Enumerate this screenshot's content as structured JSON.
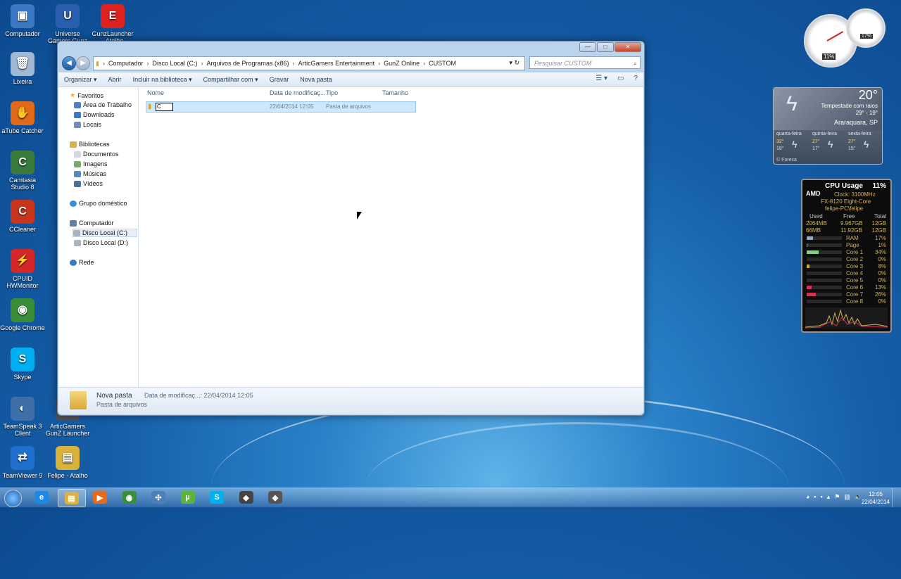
{
  "desktop": {
    "icons": [
      {
        "label": "Computador",
        "color": "#3b78c4",
        "glyph": "▣"
      },
      {
        "label": "Universe Gamers Gunz",
        "color": "#2a5fb0",
        "glyph": "U"
      },
      {
        "label": "GunzLauncher - Atelho",
        "color": "#d22",
        "glyph": "E"
      },
      {
        "label": "Lixeira",
        "color": "#9fb8d4",
        "glyph": "🗑"
      },
      {
        "label": "aTube Catcher",
        "color": "#e06a1a",
        "glyph": "✋"
      },
      {
        "label": "Camtasia Studio 8",
        "color": "#3a7a3a",
        "glyph": "C"
      },
      {
        "label": "CCleaner",
        "color": "#c8351d",
        "glyph": "C"
      },
      {
        "label": "CPUID HWMonitor",
        "color": "#d42828",
        "glyph": "⚡"
      },
      {
        "label": "Google Chrome",
        "color": "#3a8e3a",
        "glyph": "◉"
      },
      {
        "label": "Skype",
        "color": "#00aff0",
        "glyph": "S"
      },
      {
        "label": "TeamSpeak 3 Client",
        "color": "#3f6fa8",
        "glyph": "◐"
      },
      {
        "label": "ArticGamers GunZ Launcher",
        "color": "#555",
        "glyph": "A"
      },
      {
        "label": "TeamViewer 9",
        "color": "#1f6fcc",
        "glyph": "⇄"
      },
      {
        "label": "Felipe - Atalho",
        "color": "#d8b23a",
        "glyph": "▤"
      }
    ]
  },
  "explorer": {
    "window_buttons": {
      "minimize": "—",
      "maximize": "□",
      "close": "✕"
    },
    "address_segments": [
      "Computador",
      "Disco Local (C:)",
      "Arquivos de Programas (x86)",
      "ArticGamers Entertainment",
      "GunZ Online",
      "CUSTOM"
    ],
    "search_placeholder": "Pesquisar CUSTOM",
    "toolbar": [
      "Organizar ▾",
      "Abrir",
      "Incluir na biblioteca ▾",
      "Compartilhar com ▾",
      "Gravar",
      "Nova pasta"
    ],
    "nav": {
      "favorites": "Favoritos",
      "fav_items": [
        "Área de Trabalho",
        "Downloads",
        "Locais"
      ],
      "libraries": "Bibliotecas",
      "lib_items": [
        "Documentos",
        "Imagens",
        "Músicas",
        "Vídeos"
      ],
      "homegroup": "Grupo doméstico",
      "computer": "Computador",
      "drives": [
        "Disco Local (C:)",
        "Disco Local (D:)"
      ],
      "network": "Rede"
    },
    "columns": {
      "name": "Nome",
      "date": "Data de modificaç...",
      "type": "Tipo",
      "size": "Tamanho"
    },
    "file": {
      "rename_text": "C",
      "date": "22/04/2014 12:05",
      "type": "Pasta de arquivos"
    },
    "details": {
      "name": "Nova pasta",
      "type": "Pasta de arquivos",
      "date_label": "Data de modificaç...: 22/04/2014 12:05"
    }
  },
  "gadgets": {
    "clock": {
      "cpu_pct": "11%",
      "mem_pct": "17%"
    },
    "weather": {
      "temp": "20°",
      "condition": "Tempestade com raios",
      "range": "29° - 19°",
      "city": "Araraquara, SP",
      "days": [
        {
          "name": "quarta-feira",
          "hi": "32°",
          "lo": "18°"
        },
        {
          "name": "quinta-feira",
          "hi": "27°",
          "lo": "17°"
        },
        {
          "name": "sexta-feira",
          "hi": "27°",
          "lo": "15°"
        }
      ],
      "credit": "© Foreca"
    },
    "cpu": {
      "title": "CPU Usage",
      "total": "11%",
      "brand": "AMD",
      "clock": "Clock: 3100MHz",
      "model": "FX-8120 Eight-Core",
      "user": "felipe-PC\\felipe",
      "headers": [
        "Used",
        "Free",
        "Total"
      ],
      "mem_rows": [
        [
          "2064MB",
          "9.967GB",
          "12GB"
        ],
        [
          "66MB",
          "11.92GB",
          "12GB"
        ]
      ],
      "meters": [
        {
          "label": "RAM",
          "pct": "17%",
          "fill": 0.17,
          "color": "#9ab"
        },
        {
          "label": "Page",
          "pct": "1%",
          "fill": 0.01,
          "color": "#9ab"
        },
        {
          "label": "Core 1",
          "pct": "34%",
          "fill": 0.34,
          "color": "#8c8"
        },
        {
          "label": "Core 2",
          "pct": "0%",
          "fill": 0.0,
          "color": "#8c8"
        },
        {
          "label": "Core 3",
          "pct": "8%",
          "fill": 0.08,
          "color": "#da3"
        },
        {
          "label": "Core 4",
          "pct": "0%",
          "fill": 0.0,
          "color": "#da3"
        },
        {
          "label": "Core 5",
          "pct": "0%",
          "fill": 0.0,
          "color": "#c35"
        },
        {
          "label": "Core 6",
          "pct": "13%",
          "fill": 0.13,
          "color": "#c35"
        },
        {
          "label": "Core 7",
          "pct": "26%",
          "fill": 0.26,
          "color": "#c35"
        },
        {
          "label": "Core 8",
          "pct": "0%",
          "fill": 0.0,
          "color": "#c35"
        }
      ]
    }
  },
  "taskbar": {
    "apps": [
      {
        "name": "internet-explorer",
        "color": "#1e88e5",
        "glyph": "e"
      },
      {
        "name": "explorer",
        "color": "#d9b24a",
        "glyph": "▤"
      },
      {
        "name": "media-player",
        "color": "#e66a1a",
        "glyph": "▶"
      },
      {
        "name": "chrome",
        "color": "#3a8e3a",
        "glyph": "◉"
      },
      {
        "name": "network-app",
        "color": "#4d7fb8",
        "glyph": "✣"
      },
      {
        "name": "utorrent",
        "color": "#5bb53a",
        "glyph": "µ"
      },
      {
        "name": "skype",
        "color": "#00aff0",
        "glyph": "S"
      },
      {
        "name": "gunz-launcher",
        "color": "#444",
        "glyph": "◆"
      },
      {
        "name": "gunz-launcher-2",
        "color": "#555",
        "glyph": "◆"
      }
    ],
    "time": "12:05",
    "date": "22/04/2014"
  }
}
